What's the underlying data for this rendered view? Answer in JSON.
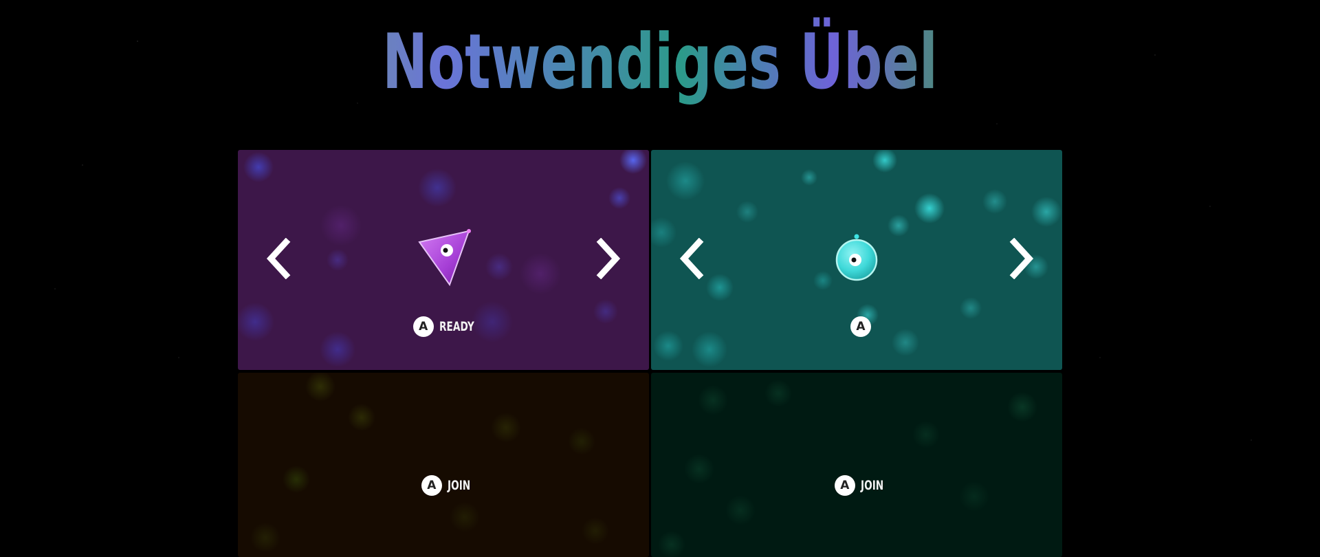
{
  "game": {
    "title": "Notwendiges Übel"
  },
  "players": [
    {
      "slot": 1,
      "state": "selecting",
      "panel_color": "#3d1749",
      "character_icon": "triangle-character",
      "character_color": "#b14de0",
      "button_glyph": "A",
      "status_label": "READY",
      "prev_icon": "chevron-left-icon",
      "next_icon": "chevron-right-icon"
    },
    {
      "slot": 2,
      "state": "selecting",
      "panel_color": "#0f5552",
      "character_icon": "circle-character",
      "character_color": "#3fd9d9",
      "button_glyph": "A",
      "status_label": "",
      "prev_icon": "chevron-left-icon",
      "next_icon": "chevron-right-icon"
    },
    {
      "slot": 3,
      "state": "empty",
      "panel_color": "#160b01",
      "button_glyph": "A",
      "status_label": "JOIN"
    },
    {
      "slot": 4,
      "state": "empty",
      "panel_color": "#001a12",
      "button_glyph": "A",
      "status_label": "JOIN"
    }
  ]
}
